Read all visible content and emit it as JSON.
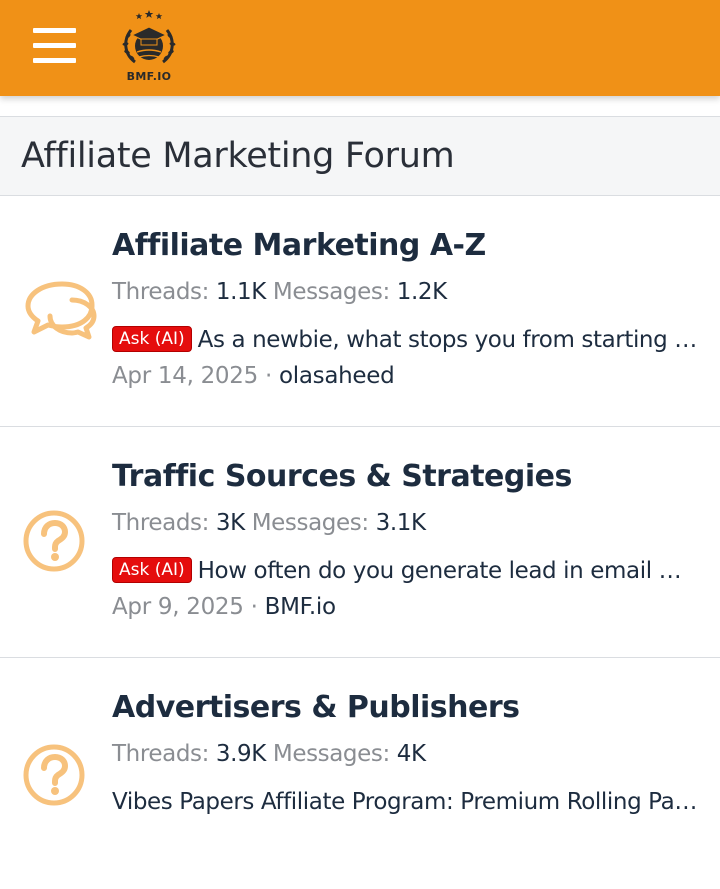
{
  "header": {
    "menu_icon": "hamburger-menu-icon",
    "logo_text": "BMF.IO",
    "brand_color": "#f09117"
  },
  "page": {
    "title": "Affiliate Marketing Forum"
  },
  "nodes": [
    {
      "icon": "chat-bubbles-icon",
      "title": "Affiliate Marketing A-Z",
      "threads_label": "Threads:",
      "threads": "1.1K",
      "messages_label": "Messages:",
      "messages": "1.2K",
      "prefix": "Ask (AI)",
      "latest_thread": "As a newbie, what stops you from starting affiliate marketing?",
      "date": "Apr 14, 2025",
      "separator": "·",
      "user": "olasaheed"
    },
    {
      "icon": "question-circle-icon",
      "title": "Traffic Sources & Strategies",
      "threads_label": "Threads:",
      "threads": "3K",
      "messages_label": "Messages:",
      "messages": "3.1K",
      "prefix": "Ask (AI)",
      "latest_thread": "How often do you generate lead in email marketing?",
      "date": "Apr 9, 2025",
      "separator": "·",
      "user": "BMF.io"
    },
    {
      "icon": "question-circle-icon",
      "title": "Advertisers & Publishers",
      "threads_label": "Threads:",
      "threads": "3.9K",
      "messages_label": "Messages:",
      "messages": "4K",
      "latest_thread": "Vibes Papers Affiliate Program: Premium Rolling Papers"
    }
  ]
}
